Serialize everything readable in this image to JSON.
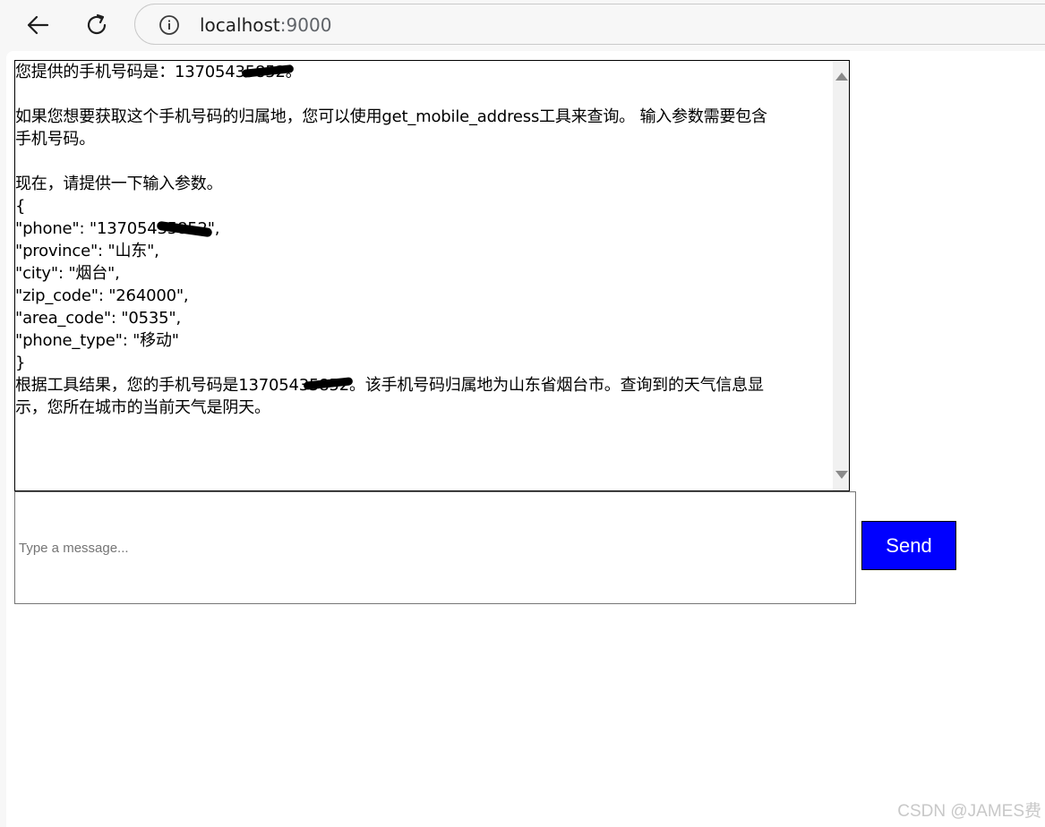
{
  "browser": {
    "url_host": "localhost",
    "url_port": ":9000",
    "back_icon": "arrow-left-icon",
    "reload_icon": "reload-icon",
    "info_icon": "info-icon"
  },
  "chat": {
    "lines": [
      "您提供的手机号码是：13705435852。",
      "",
      "如果您想要获取这个手机号码的归属地，您可以使用get_mobile_address工具来查询。 输入参数需要包含",
      "手机号码。",
      "",
      "现在，请提供一下输入参数。",
      "{",
      "\"phone\": \"13705435852\",",
      "\"province\": \"山东\",",
      "\"city\": \"烟台\",",
      "\"zip_code\": \"264000\",",
      "\"area_code\": \"0535\",",
      "\"phone_type\": \"移动\"",
      "}",
      "根据工具结果，您的手机号码是13705435852。该手机号码归属地为山东省烟台市。查询到的天气信息显",
      "示，您所在城市的当前天气是阴天。"
    ]
  },
  "input": {
    "placeholder": "Type a message..."
  },
  "send_label": "Send",
  "watermark": "CSDN @JAMES费",
  "colors": {
    "send_button": "#0000ff",
    "send_text": "#ffffff"
  }
}
